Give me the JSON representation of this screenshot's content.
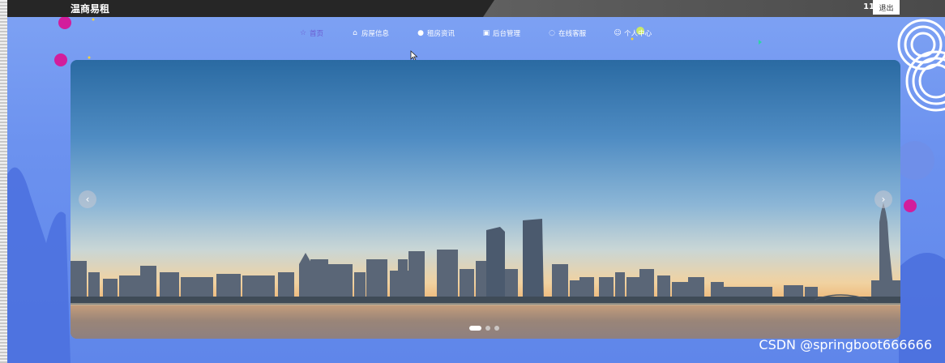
{
  "header": {
    "brand": "温商易租",
    "user_id": "11",
    "logout_label": "退出"
  },
  "nav": {
    "items": [
      {
        "label": "首页",
        "icon": "star-icon",
        "glyph": "☆",
        "active": true
      },
      {
        "label": "房屋信息",
        "icon": "home-icon",
        "glyph": "⌂",
        "active": false
      },
      {
        "label": "租房资讯",
        "icon": "info-icon",
        "glyph": "●",
        "active": false
      },
      {
        "label": "后台管理",
        "icon": "briefcase-icon",
        "glyph": "▣",
        "active": false
      },
      {
        "label": "在线客服",
        "icon": "headset-icon",
        "glyph": "◌",
        "active": false
      },
      {
        "label": "个人中心",
        "icon": "user-icon",
        "glyph": "☺",
        "active": false
      }
    ]
  },
  "carousel": {
    "prev_icon": "chevron-left-icon",
    "prev_glyph": "‹",
    "next_icon": "chevron-right-icon",
    "next_glyph": "›",
    "slide_count": 3,
    "active_slide": 1,
    "image_subject": "city skyline at sunset over river"
  },
  "watermark": "CSDN @springboot666666",
  "colors": {
    "topbar": "#262626",
    "page_bg": "#6c92ef",
    "nav_active": "#6b5cd1",
    "bubble": "#d21d9c"
  }
}
